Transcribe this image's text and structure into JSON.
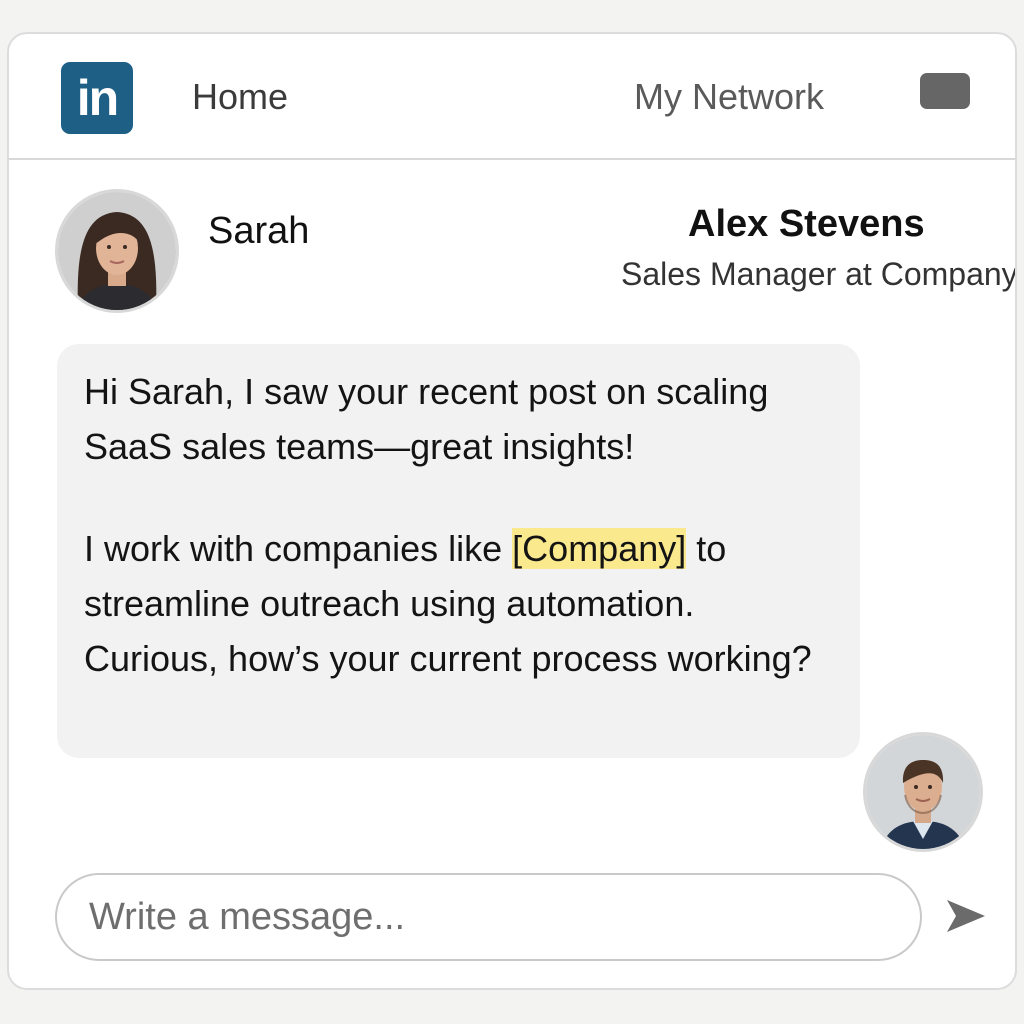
{
  "nav": {
    "logo_text": "in",
    "home_label": "Home",
    "network_label": "My Network",
    "messaging_icon": "message-square-icon"
  },
  "conversation": {
    "recipient_name": "Sarah",
    "sender_name": "Alex Stevens",
    "sender_title": "Sales Manager at Company"
  },
  "message": {
    "paragraph1": "Hi Sarah, I saw your recent post on scaling SaaS sales teams—great insights!",
    "p2_before": "I work with companies like",
    "p2_highlight": "[Company]",
    "p2_after": "to streamline outreach using automation. Curious, how’s your current process working?"
  },
  "composer": {
    "placeholder": "Write a message...",
    "send_icon": "send-arrow-icon"
  },
  "colors": {
    "brand": "#1e5f86",
    "highlight": "#fbe98e",
    "bubble": "#f2f2f2"
  }
}
